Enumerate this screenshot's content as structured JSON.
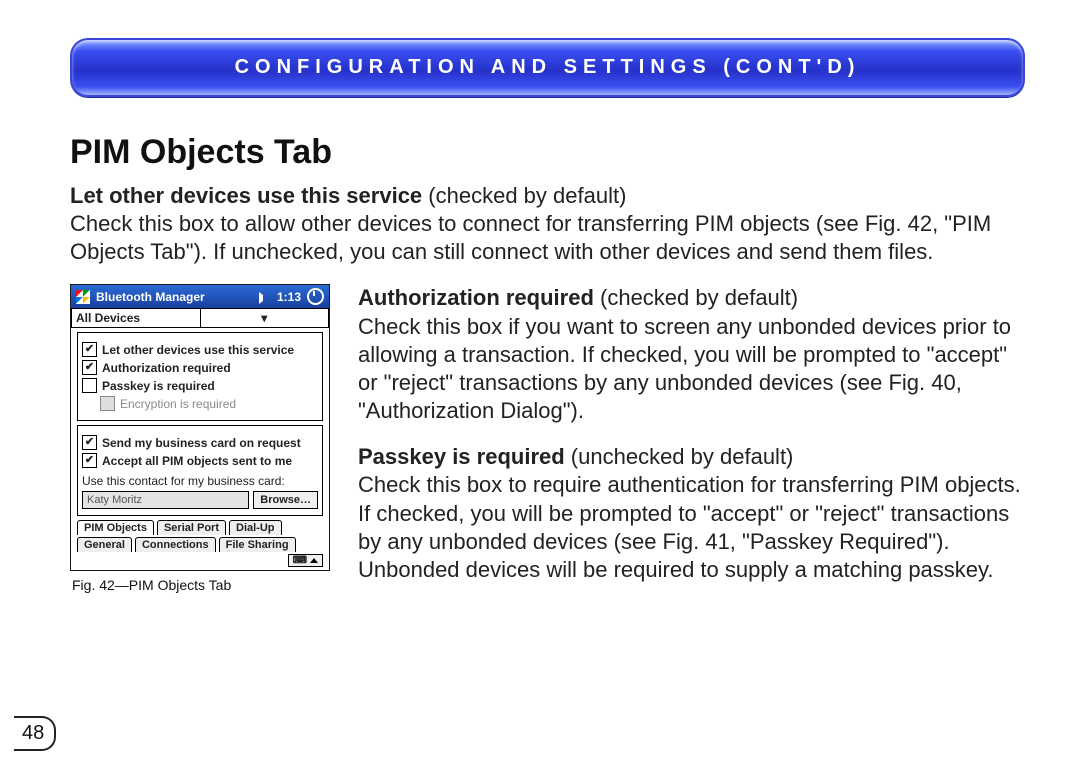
{
  "banner": "CONFIGURATION AND SETTINGS (CONT'D)",
  "heading": "PIM Objects Tab",
  "intro_bold": "Let other devices use this service",
  "intro_note": " (checked by default)",
  "intro_body": "Check this box to allow other devices to connect for transferring PIM objects (see Fig. 42, \"PIM Objects Tab\"). If unchecked, you can still connect with other devices and send them files.",
  "auth_bold": "Authorization required",
  "auth_note": " (checked by default)",
  "auth_body": "Check this box if you want to screen any unbonded devices prior to allowing a transaction. If checked, you will be prompted to \"accept\" or \"reject\" transactions by any unbonded devices (see Fig. 40, \"Authorization Dialog\").",
  "pass_bold": "Passkey is required",
  "pass_note": " (unchecked by default)",
  "pass_body": "Check this box to require authentication for transferring PIM objects. If checked, you will be prompted to \"accept\" or \"reject\" transactions by any unbonded devices (see Fig. 41, \"Passkey Required\"). Unbonded devices will be required to supply a matching passkey.",
  "caption": "Fig. 42—PIM Objects Tab",
  "page_number": "48",
  "pda": {
    "title": "Bluetooth Manager",
    "time": "1:13",
    "dropdown": "All Devices",
    "opts": {
      "let_other": "Let other devices use this service",
      "auth": "Authorization required",
      "passkey": "Passkey is required",
      "encrypt": "Encryption is required",
      "send_card": "Send my business card on request",
      "accept_all": "Accept all PIM objects sent to me",
      "use_contact": "Use this contact for my business card:"
    },
    "contact_value": "Katy Moritz",
    "browse": "Browse…",
    "tabs_top": [
      "PIM Objects",
      "Serial Port",
      "Dial-Up"
    ],
    "tabs_bottom": [
      "General",
      "Connections",
      "File Sharing"
    ]
  }
}
